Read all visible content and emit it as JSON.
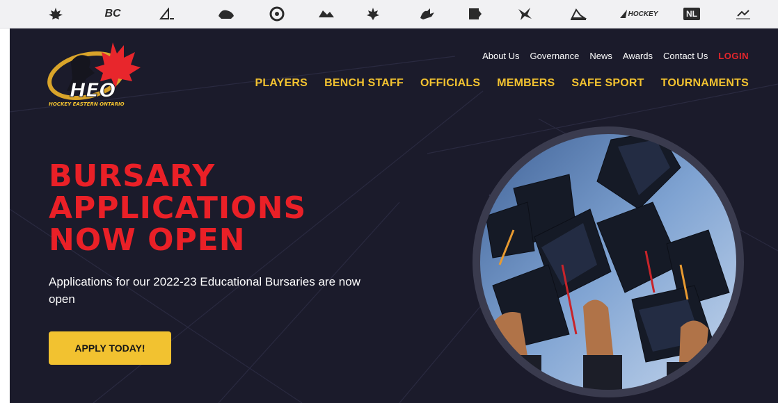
{
  "partner_logos": [
    {
      "name": "hockey-canada-logo-icon",
      "text": ""
    },
    {
      "name": "bc-hockey-logo-icon",
      "text": "BC"
    },
    {
      "name": "hockey-alberta-logo-icon",
      "text": ""
    },
    {
      "name": "sask-hockey-logo-icon",
      "text": ""
    },
    {
      "name": "hockey-manitoba-logo-icon",
      "text": ""
    },
    {
      "name": "hockey-northwestern-ontario-logo-icon",
      "text": ""
    },
    {
      "name": "ohf-logo-icon",
      "text": ""
    },
    {
      "name": "hockey-eastern-ontario-logo-icon",
      "text": ""
    },
    {
      "name": "hockey-quebec-logo-icon",
      "text": ""
    },
    {
      "name": "hockey-new-brunswick-logo-icon",
      "text": ""
    },
    {
      "name": "hockey-pei-logo-icon",
      "text": ""
    },
    {
      "name": "hockey-nova-scotia-logo-icon",
      "text": "HOCKEY"
    },
    {
      "name": "hockey-nl-logo-icon",
      "text": "NL"
    },
    {
      "name": "hockey-north-logo-icon",
      "text": ""
    }
  ],
  "header": {
    "logo_text": "HEO",
    "logo_subtext": "HOCKEY EASTERN ONTARIO"
  },
  "util_nav": {
    "about": "About Us",
    "governance": "Governance",
    "news": "News",
    "awards": "Awards",
    "contact": "Contact Us",
    "login": "LOGIN"
  },
  "main_nav": {
    "players": "PLAYERS",
    "bench_staff": "BENCH STAFF",
    "officials": "OFFICIALS",
    "members": "MEMBERS",
    "safe_sport": "SAFE SPORT",
    "tournaments": "TOURNAMENTS"
  },
  "hero": {
    "headline_line1": "BURSARY",
    "headline_line2": "APPLICATIONS",
    "headline_line3": "NOW OPEN",
    "subtext": "Applications for our 2022-23 Educational Bursaries are now open",
    "cta_label": "APPLY TODAY!"
  },
  "colors": {
    "background": "#1b1b2b",
    "headline_red": "#ea2027",
    "nav_yellow": "#f2c230",
    "button_yellow": "#f2c230"
  }
}
